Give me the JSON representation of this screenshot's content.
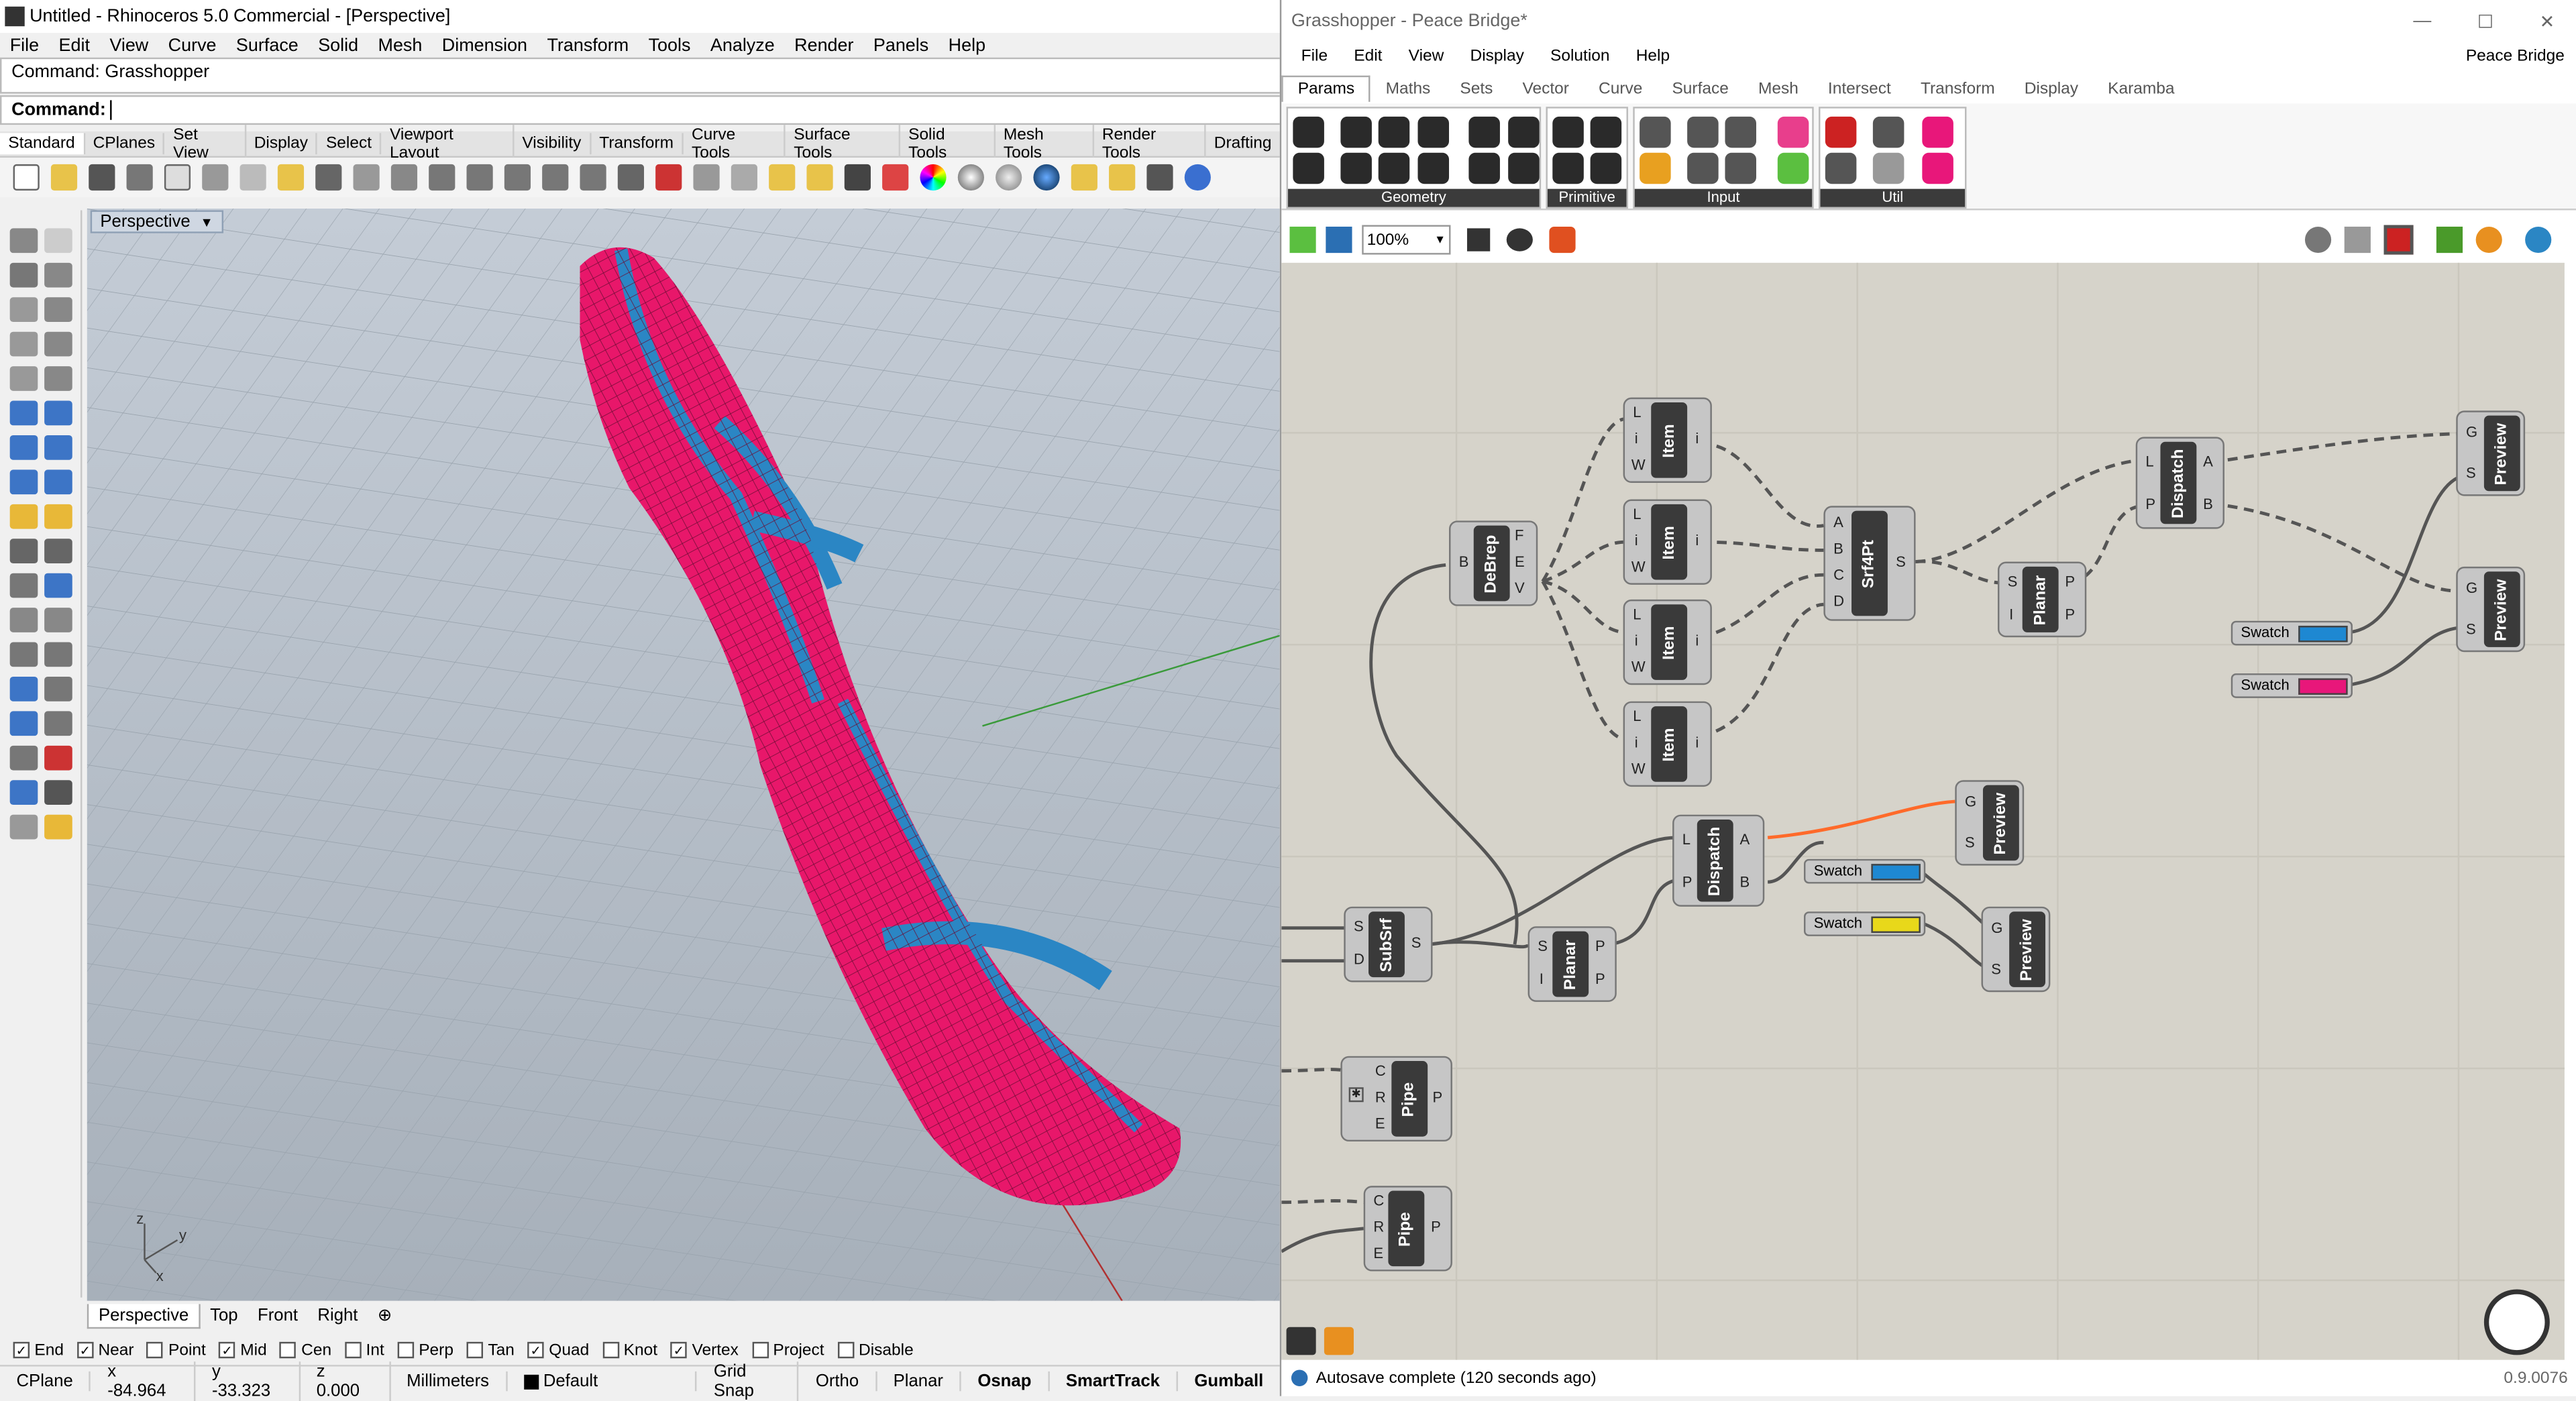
{
  "rhino": {
    "title": "Untitled - Rhinoceros 5.0 Commercial - [Perspective]",
    "menu": [
      "File",
      "Edit",
      "View",
      "Curve",
      "Surface",
      "Solid",
      "Mesh",
      "Dimension",
      "Transform",
      "Tools",
      "Analyze",
      "Render",
      "Panels",
      "Help"
    ],
    "command_history": "Command: Grasshopper",
    "command_prompt": "Command:",
    "toolbar_tabs": [
      "Standard",
      "CPlanes",
      "Set View",
      "Display",
      "Select",
      "Viewport Layout",
      "Visibility",
      "Transform",
      "Curve Tools",
      "Surface Tools",
      "Solid Tools",
      "Mesh Tools",
      "Render Tools",
      "Drafting"
    ],
    "viewport_label": "Perspective",
    "viewport_tabs": [
      "Perspective",
      "Top",
      "Front",
      "Right"
    ],
    "axis_labels": {
      "z": "z",
      "y": "y",
      "x": "x"
    },
    "osnaps": [
      {
        "label": "End",
        "checked": true
      },
      {
        "label": "Near",
        "checked": true
      },
      {
        "label": "Point",
        "checked": false
      },
      {
        "label": "Mid",
        "checked": true
      },
      {
        "label": "Cen",
        "checked": false
      },
      {
        "label": "Int",
        "checked": false
      },
      {
        "label": "Perp",
        "checked": false
      },
      {
        "label": "Tan",
        "checked": false
      },
      {
        "label": "Quad",
        "checked": true
      },
      {
        "label": "Knot",
        "checked": false
      },
      {
        "label": "Vertex",
        "checked": true
      },
      {
        "label": "Project",
        "checked": false
      },
      {
        "label": "Disable",
        "checked": false
      }
    ],
    "status": {
      "cplane": "CPlane",
      "x": "x -84.964",
      "y": "y -33.323",
      "z": "z 0.000",
      "units": "Millimeters",
      "layer": "Default",
      "grid_snap": "Grid Snap",
      "ortho": "Ortho",
      "planar": "Planar",
      "osnap": "Osnap",
      "smarttrack": "SmartTrack",
      "gumball": "Gumball"
    },
    "colors": {
      "surface": "#e8176a",
      "panel": "#2b86c4"
    }
  },
  "gh": {
    "title": "Grasshopper - Peace Bridge*",
    "menu": [
      "File",
      "Edit",
      "View",
      "Display",
      "Solution",
      "Help"
    ],
    "doc_name": "Peace Bridge",
    "tabs": [
      "Params",
      "Maths",
      "Sets",
      "Vector",
      "Curve",
      "Surface",
      "Mesh",
      "Intersect",
      "Transform",
      "Display",
      "Karamba"
    ],
    "groups": [
      "Geometry",
      "Primitive",
      "Input",
      "Util"
    ],
    "zoom": "100%",
    "components": {
      "debrep": "DeBrep",
      "item": "Item",
      "srf4pt": "Srf4Pt",
      "planar": "Planar",
      "dispatch": "Dispatch",
      "preview": "Preview",
      "subsrf": "SubSrf",
      "pipe": "Pipe",
      "swatch": "Swatch"
    },
    "swatch_colors": {
      "blue": "#1e88d2",
      "magenta": "#e8177a",
      "yellow": "#e8d81a"
    },
    "status_msg": "Autosave complete (120 seconds ago)",
    "version": "0.9.0076"
  }
}
